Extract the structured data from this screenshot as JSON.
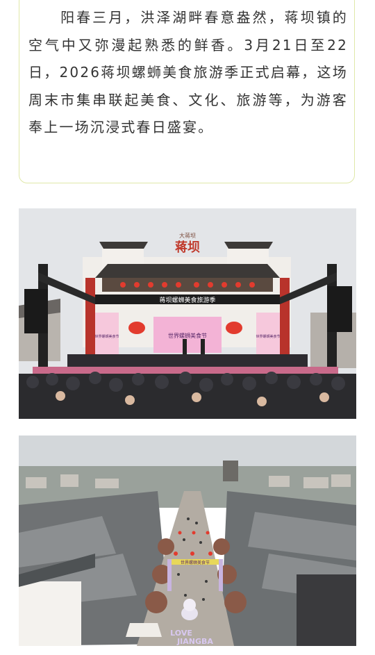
{
  "article": {
    "intro_paragraph": "　　阳春三月，洪泽湖畔春意盎然，蒋坝镇的空气中又弥漫起熟悉的鲜香。3月21日至22日，2026蒋坝螺蛳美食旅游季正式启幕，这场周末市集串联起美食、文化、旅游等，为游客奉上一场沉浸式春日盛宴。"
  },
  "photo1": {
    "gate_sign": "蒋坝",
    "gate_top_small": "大蒋坝",
    "stage_banner": "蒋坝螺蛳美食旅游季",
    "screen_caption": "世界螺蛳美食节",
    "side_poster_left": "世界螺蛳美食节",
    "side_poster_right": "世界螺蛳美食节"
  },
  "photo2": {
    "ground_sign_line1": "LOVE",
    "ground_sign_line2": "JIANGBA",
    "arch_text": "世界螺蛳美食节"
  },
  "colors": {
    "frame_border": "#dfe8a8",
    "body_text": "#333333",
    "sky": "#dfe2e6",
    "stage_red": "#c8102e",
    "lantern_red": "#e23b2e",
    "pink_screen": "#f3b3d6"
  }
}
